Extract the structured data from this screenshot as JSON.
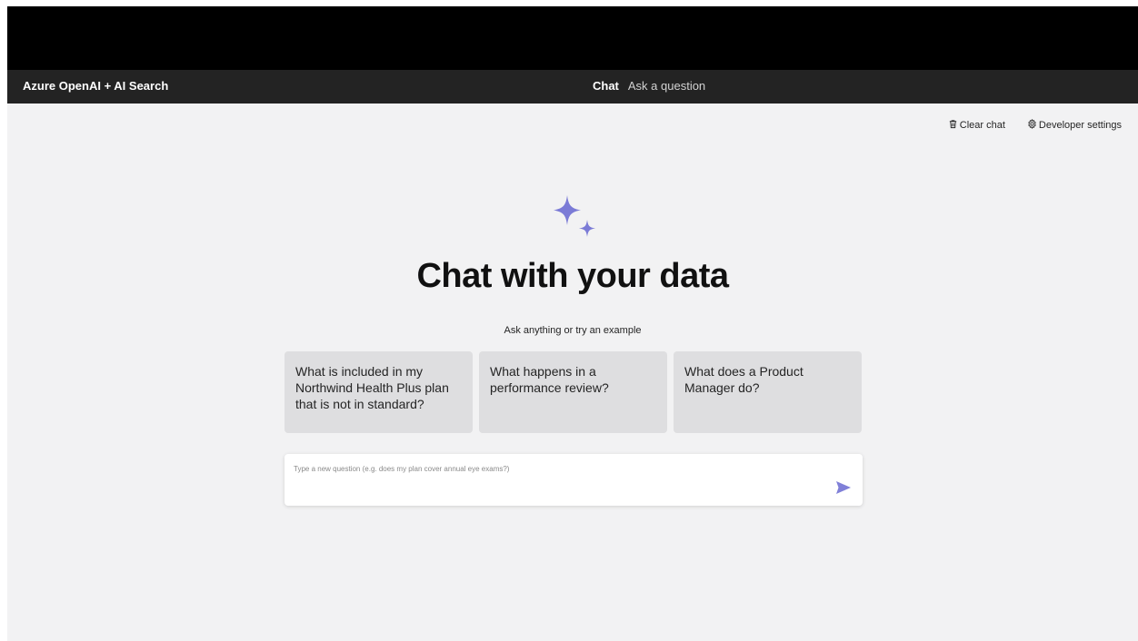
{
  "header": {
    "brand": "Azure OpenAI + AI Search",
    "nav": {
      "chat": "Chat",
      "ask": "Ask a question"
    }
  },
  "toolbar": {
    "clear_chat": "Clear chat",
    "developer_settings": "Developer settings"
  },
  "hero": {
    "title": "Chat with your data",
    "subtitle": "Ask anything or try an example",
    "icon": "sparkle-icon"
  },
  "examples": [
    {
      "text": "What is included in my Northwind Health Plus plan that is not in standard?"
    },
    {
      "text": "What happens in a performance review?"
    },
    {
      "text": "What does a Product Manager do?"
    }
  ],
  "question_input": {
    "placeholder": "Type a new question (e.g. does my plan cover annual eye exams?)",
    "value": ""
  },
  "colors": {
    "accent": "#7b7bd6",
    "header_bg": "#232323",
    "page_bg": "#f2f2f3",
    "card_bg": "#dedee0"
  }
}
